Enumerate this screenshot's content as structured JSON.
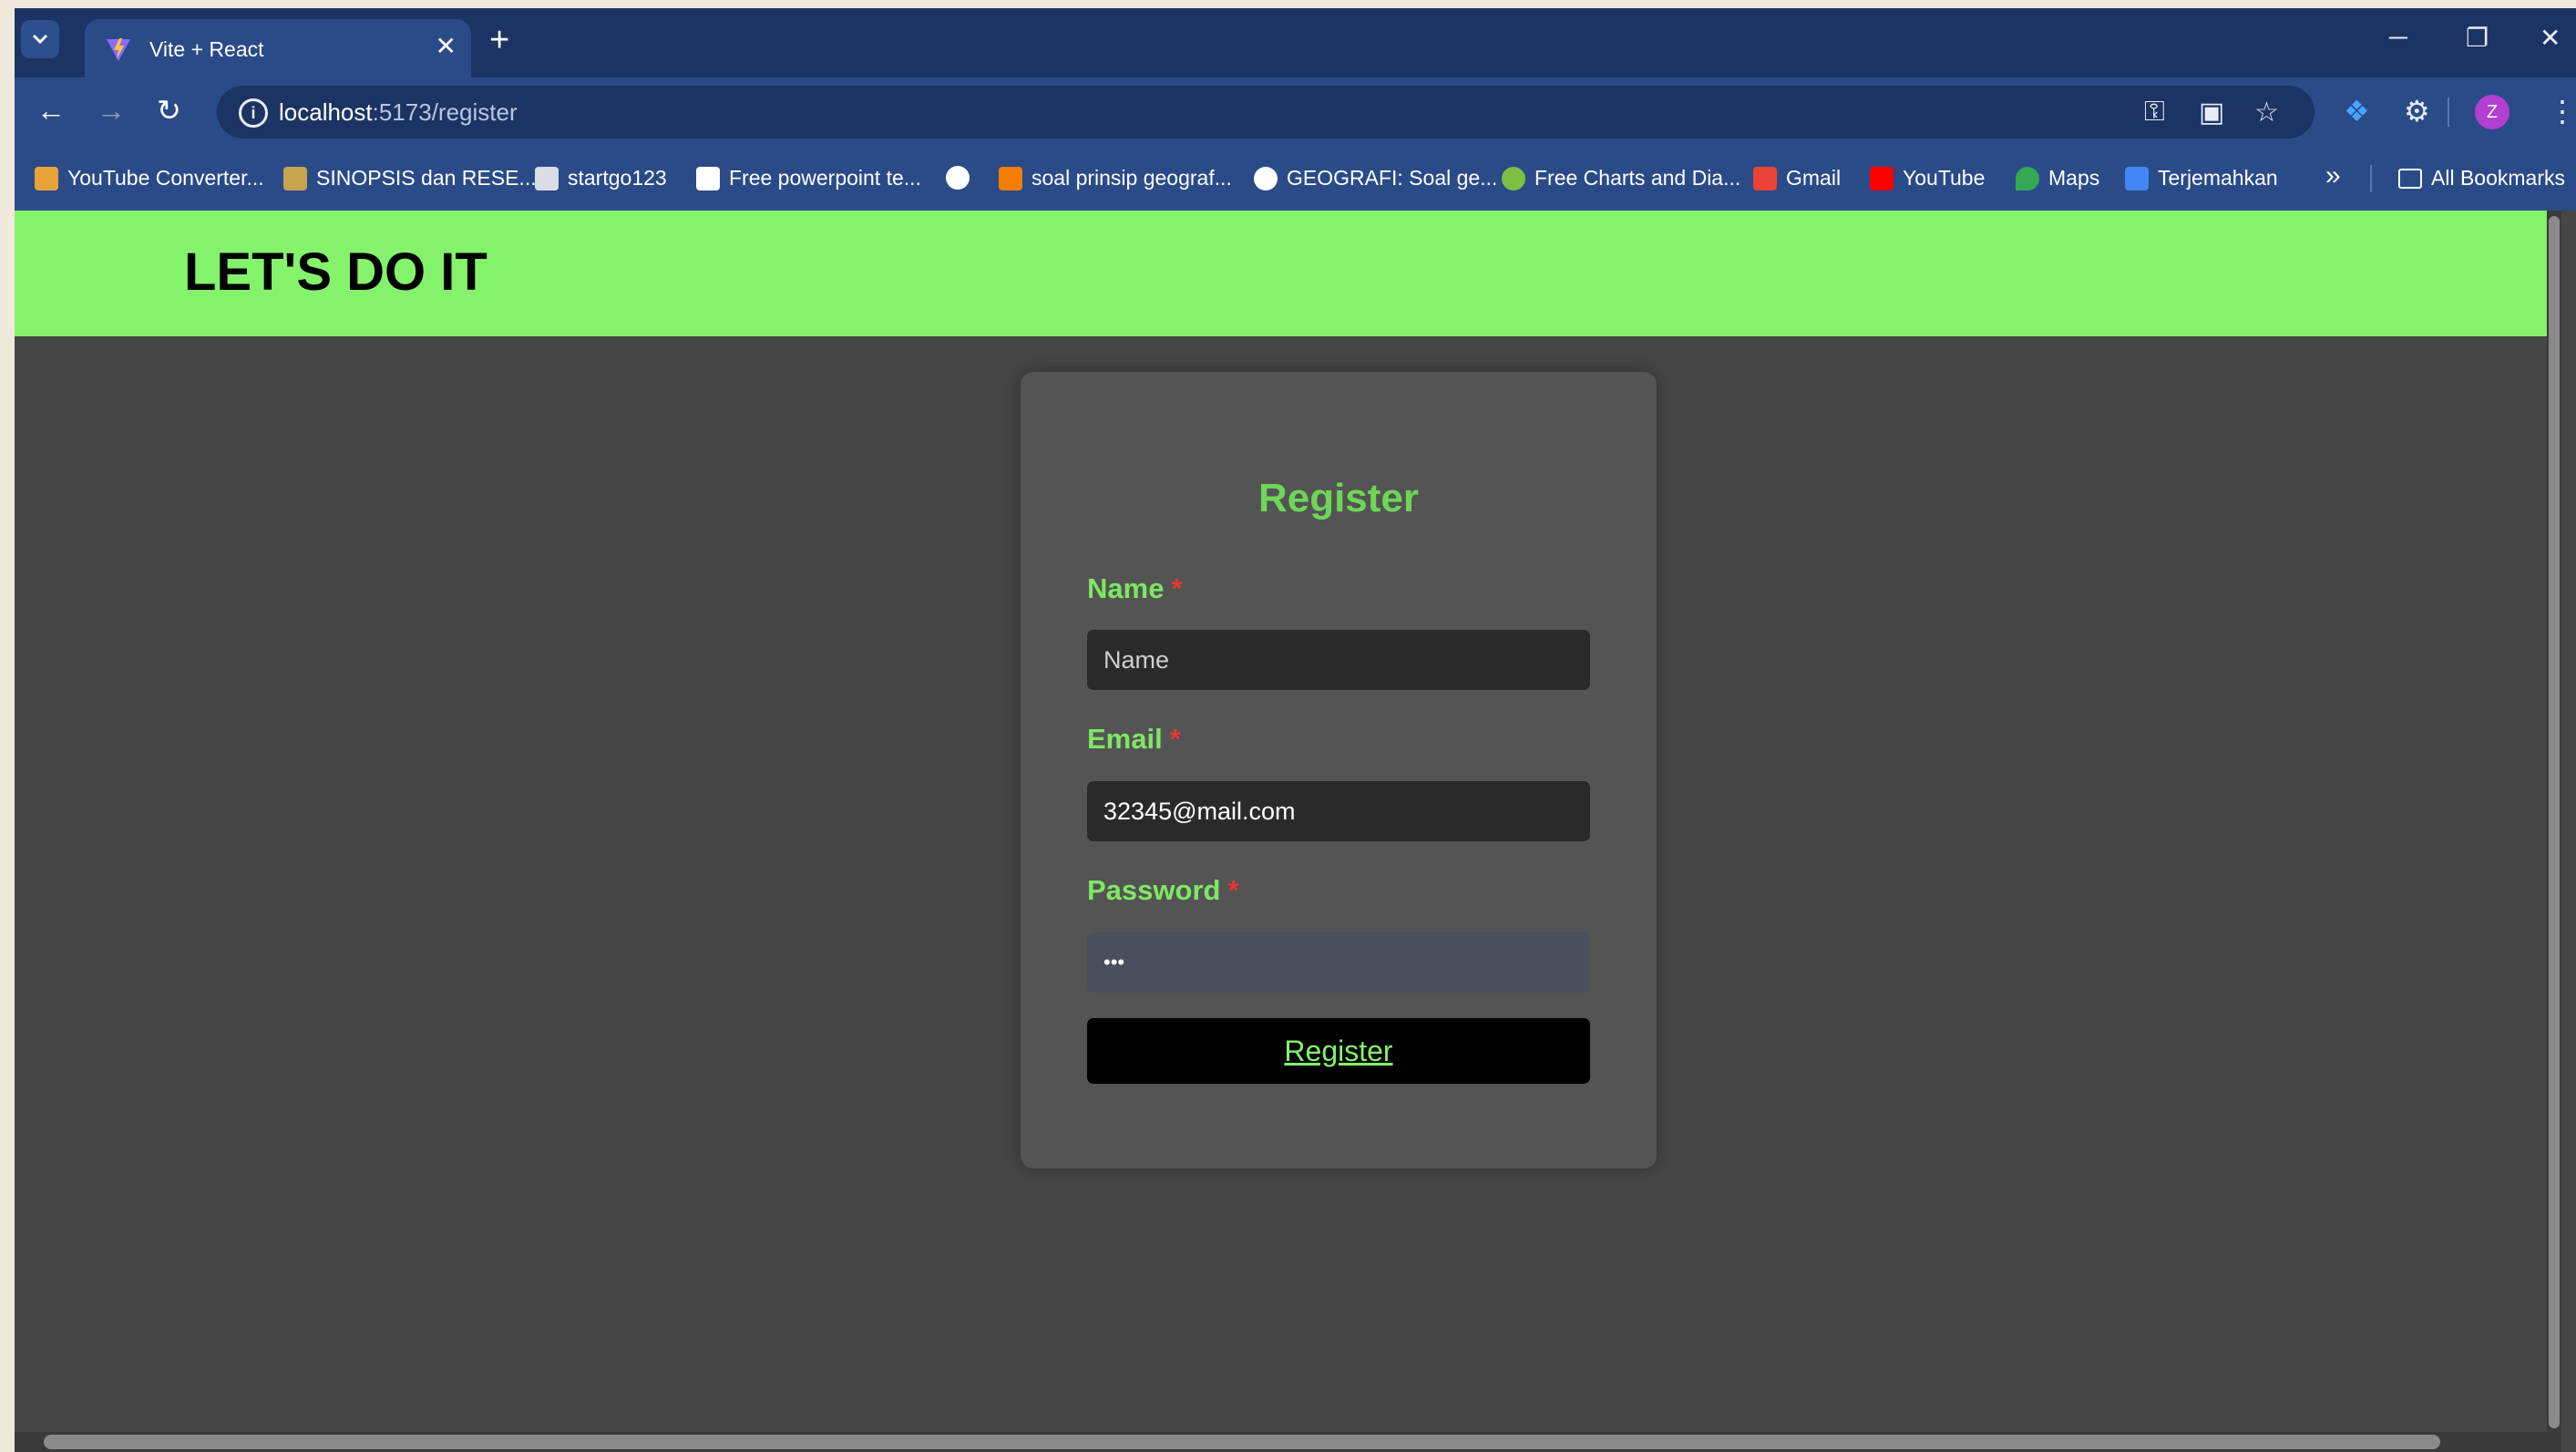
{
  "browser": {
    "tab": {
      "title": "Vite + React",
      "close": "✕"
    },
    "new_tab": "+",
    "window_controls": {
      "minimize": "─",
      "restore": "❐",
      "close": "✕"
    },
    "url": {
      "host": "localhost",
      "path": ":5173/register"
    },
    "bookmarks": [
      {
        "label": "YouTube Converter...",
        "icon": "converter-icon",
        "color": "#e8a33a"
      },
      {
        "label": "SINOPSIS dan RESE...",
        "icon": "film-icon",
        "color": "#c7a350"
      },
      {
        "label": "startgo123",
        "icon": "startgo-icon",
        "color": "#d8dde6"
      },
      {
        "label": "Free powerpoint te...",
        "icon": "powerpoint-icon",
        "color": "#ffffff"
      },
      {
        "label": "",
        "icon": "globe-icon",
        "color": "#ffffff"
      },
      {
        "label": "soal prinsip geograf...",
        "icon": "blogger-icon",
        "color": "#f57d00"
      },
      {
        "label": "GEOGRAFI: Soal ge...",
        "icon": "globe-icon",
        "color": "#ffffff"
      },
      {
        "label": "Free Charts and Dia...",
        "icon": "charts-icon",
        "color": "#7bc043"
      },
      {
        "label": "Gmail",
        "icon": "gmail-icon",
        "color": "#ea4335"
      },
      {
        "label": "YouTube",
        "icon": "youtube-icon",
        "color": "#ff0000"
      },
      {
        "label": "Maps",
        "icon": "maps-icon",
        "color": "#34a853"
      },
      {
        "label": "Terjemahkan",
        "icon": "translate-icon",
        "color": "#4285f4"
      }
    ],
    "bookmarks_overflow": "»",
    "all_bookmarks": "All Bookmarks",
    "profile_initial": "Z"
  },
  "app": {
    "logo": "LET'S DO IT",
    "form": {
      "title": "Register",
      "name_label": "Name",
      "name_placeholder": "Name",
      "email_label": "Email",
      "email_value": "32345@mail.com",
      "password_label": "Password",
      "password_value": "•••",
      "required_mark": "*",
      "submit_label": "Register"
    }
  }
}
